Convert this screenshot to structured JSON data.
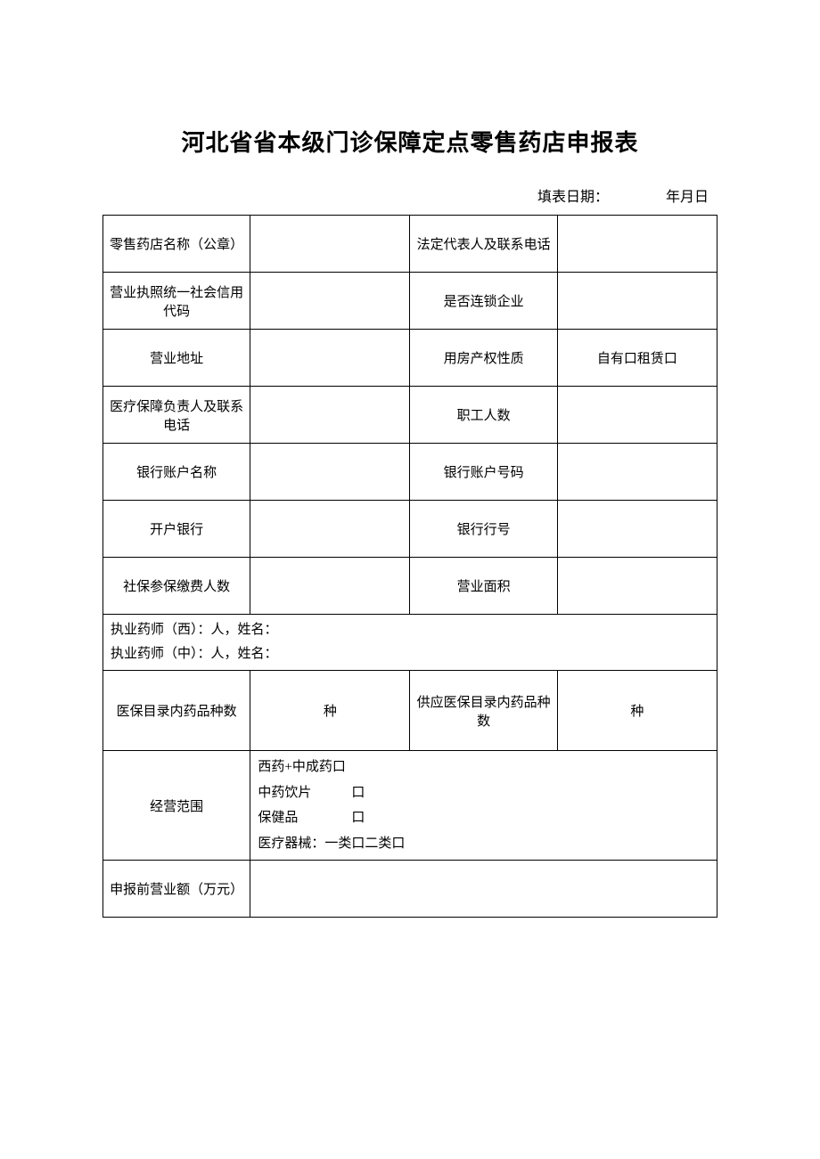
{
  "title": "河北省省本级门诊保障定点零售药店申报表",
  "dateLabel": "填表日期：",
  "dateValue": "年月日",
  "rows": {
    "storeName": "零售药店名称（公章）",
    "legalRep": "法定代表人及联系电话",
    "licenseCode": "营业执照统一社会信用代码",
    "isChain": "是否连锁企业",
    "address": "营业地址",
    "propertyNature": "用房产权性质",
    "propertyValue": "自有口租赁口",
    "medManager": "医疗保障负责人及联系电话",
    "employeeCount": "职工人数",
    "bankAccountName": "银行账户名称",
    "bankAccountNo": "银行账户号码",
    "bankName": "开户银行",
    "bankCode": "银行行号",
    "insuredCount": "社保参保缴费人数",
    "businessArea": "营业面积",
    "pharmacistWest": "执业药师（西）：人，姓名：",
    "pharmacistChinese": "执业药师（中）：人，姓名：",
    "drugTypesInCatalog": "医保目录内药品种数",
    "drugTypesUnit": "种",
    "supplyDrugTypes": "供应医保目录内药品种数",
    "supplyDrugTypesUnit": "种",
    "businessScope": "经营范围",
    "scopeLine1": "西药+中成药口",
    "scopeLine2": "中药饮片　　　口",
    "scopeLine3": "保健品　　　　口",
    "scopeLine4": "医疗器械：一类口二类口",
    "preRevenue": "申报前营业额（万元）"
  }
}
